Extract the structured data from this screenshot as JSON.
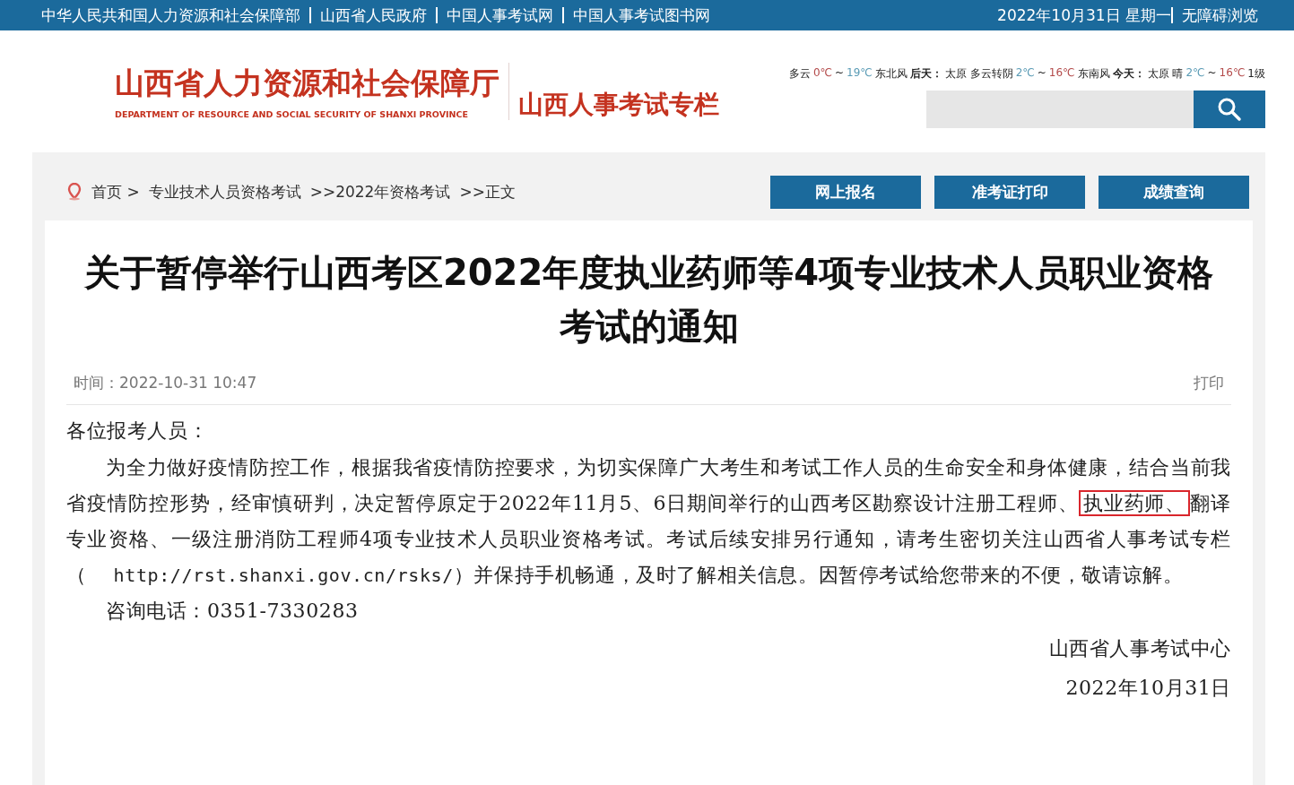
{
  "top_bar": {
    "links": [
      "中华人民共和国人力资源和社会保障部",
      "山西省人民政府",
      "中国人事考试网",
      "中国人事考试图书网"
    ],
    "date": "2022年10月31日 星期一",
    "accessibility": "无障碍浏览"
  },
  "header": {
    "org_name": "山西省人力资源和社会保障厅",
    "org_name_en": "DEPARTMENT OF RESOURCE AND SOCIAL SECURITY OF SHANXI PROVINCE",
    "column_title": "山西人事考试专栏",
    "weather": [
      {
        "kind": "text",
        "text": "多云"
      },
      {
        "kind": "low",
        "text": "0℃"
      },
      {
        "kind": "text",
        "text": "~"
      },
      {
        "kind": "high",
        "text": "19℃"
      },
      {
        "kind": "text",
        "text": "东北风"
      },
      {
        "kind": "bold",
        "text": "后天："
      },
      {
        "kind": "text",
        "text": "太原 多云转阴"
      },
      {
        "kind": "high",
        "text": "2℃"
      },
      {
        "kind": "text",
        "text": "~"
      },
      {
        "kind": "low",
        "text": "16℃"
      },
      {
        "kind": "text",
        "text": "东南风"
      },
      {
        "kind": "bold",
        "text": "今天："
      },
      {
        "kind": "text",
        "text": "太原 晴"
      },
      {
        "kind": "high",
        "text": "2℃"
      },
      {
        "kind": "text",
        "text": "~"
      },
      {
        "kind": "low",
        "text": "16℃"
      },
      {
        "kind": "text",
        "text": "1级"
      }
    ]
  },
  "breadcrumb": [
    "首页 >",
    "专业技术人员资格考试",
    ">>2022年资格考试",
    ">>正文"
  ],
  "nav_buttons": [
    "网上报名",
    "准考证打印",
    "成绩查询"
  ],
  "article": {
    "title": "关于暂停举行山西考区2022年度执业药师等4项专业技术人员职业资格考试的通知",
    "time": "时间：2022-10-31 10:47",
    "print": "打印",
    "greeting": "各位报考人员：",
    "paragraph": [
      {
        "text": "为全力做好疫情防控工作，根据我省疫情防控要求，为切实保障广大考生和考试工作人员的生命安全和身体健康，结合当前我省疫情防控形势，经审慎研判，决定暂停原定于2022年11月5、6日期间举行的山西考区勘察设计注册工程师、",
        "highlighted": false
      },
      {
        "text": "执业药师、",
        "highlighted": true
      },
      {
        "text": "翻译专业资格、一级注册消防工程师4项专业技术人员职业资格考试。考试后续安排另行通知，请考生密切关注山西省人事考试专栏（",
        "highlighted": false
      },
      {
        "text": "http://rst.shanxi.gov.cn/rsks/",
        "highlighted": false,
        "kind": "link"
      },
      {
        "text": "）并保持手机畅通，及时了解相关信息。因暂停考试给您带来的不便，敬请谅解。",
        "highlighted": false
      }
    ],
    "contact": "咨询电话：0351-7330283",
    "signature": "山西省人事考试中心",
    "date": "2022年10月31日"
  }
}
